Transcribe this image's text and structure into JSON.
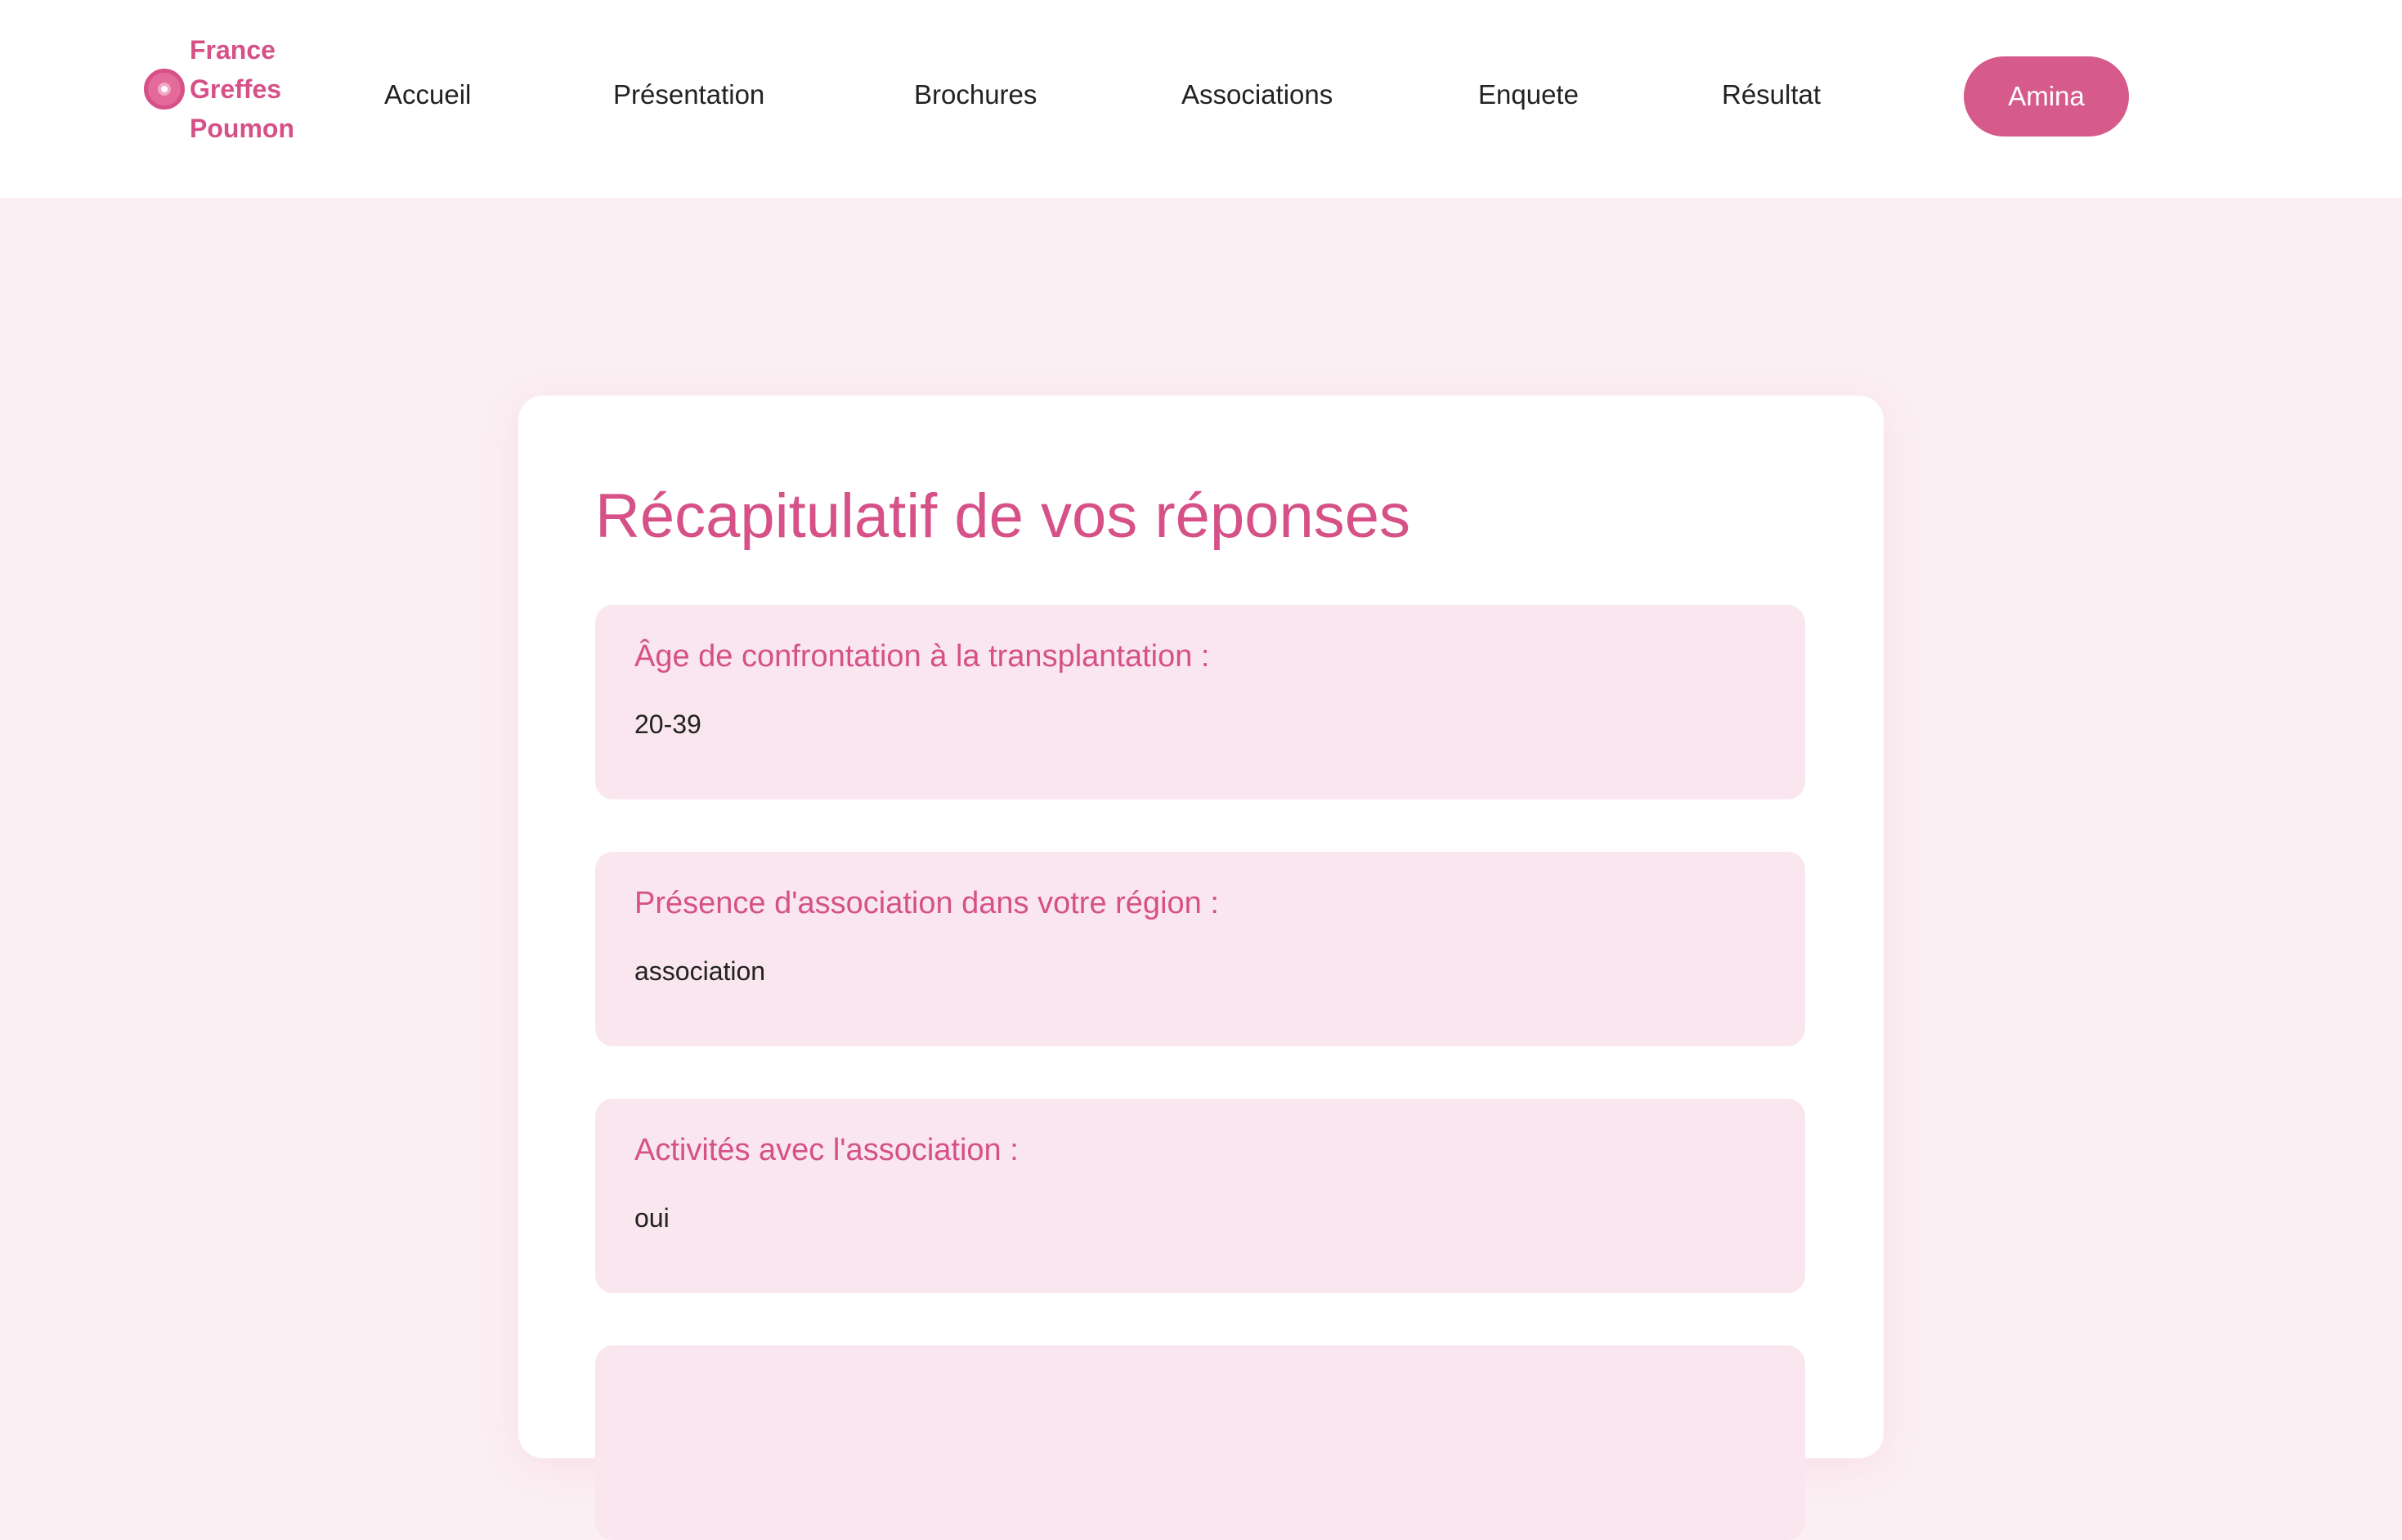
{
  "header": {
    "logo": {
      "icon": "lung-badge-icon",
      "lines": [
        "France",
        "Greffes",
        "Poumon"
      ]
    },
    "nav": [
      {
        "label": "Accueil"
      },
      {
        "label": "Présentation"
      },
      {
        "label": "Brochures"
      },
      {
        "label": "Associations"
      },
      {
        "label": "Enquete"
      },
      {
        "label": "Résultat"
      }
    ],
    "user_button": "Amina"
  },
  "main": {
    "title": "Récapitulatif de vos réponses",
    "answers": [
      {
        "question": "Âge de confrontation à la transplantation :",
        "answer": "20-39"
      },
      {
        "question": "Présence d'association dans votre région :",
        "answer": "association"
      },
      {
        "question": "Activités avec l'association :",
        "answer": "oui"
      }
    ]
  },
  "colors": {
    "accent": "#d55187",
    "button": "#d65a8a",
    "page_background": "#fbeff3",
    "answer_background": "#f9e6ee"
  }
}
